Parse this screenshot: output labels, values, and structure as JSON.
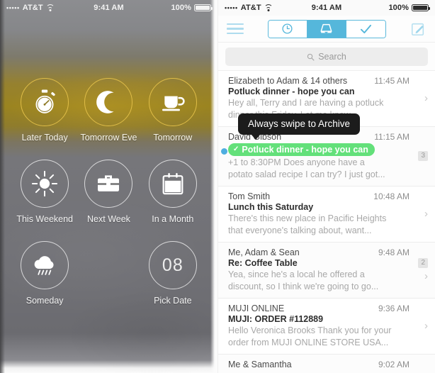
{
  "left_phone": {
    "statusbar": {
      "carrier": "AT&T",
      "signal_dots": "•••••",
      "time": "9:41 AM",
      "battery": "100%",
      "wifi_icon": "wifi-icon",
      "battery_icon": "battery-full-icon"
    },
    "snooze_options": [
      {
        "label": "Later Today",
        "icon": "stopwatch-icon",
        "accent": "gold"
      },
      {
        "label": "Tomorrow Eve",
        "icon": "moon-icon",
        "accent": "gold"
      },
      {
        "label": "Tomorrow",
        "icon": "coffee-cup-icon",
        "accent": "gold"
      },
      {
        "label": "This Weekend",
        "icon": "sun-icon",
        "accent": "white"
      },
      {
        "label": "Next Week",
        "icon": "briefcase-icon",
        "accent": "white"
      },
      {
        "label": "In a Month",
        "icon": "calendar-icon",
        "accent": "white"
      },
      {
        "label": "Someday",
        "icon": "rain-cloud-icon",
        "accent": "white"
      },
      {
        "label": "",
        "icon": "",
        "accent": "none"
      },
      {
        "label": "Pick Date",
        "icon": "date-number-icon",
        "accent": "white",
        "day_number": "08"
      }
    ]
  },
  "right_phone": {
    "statusbar": {
      "carrier": "AT&T",
      "signal_dots": "•••••",
      "time": "9:41 AM",
      "battery": "100%",
      "wifi_icon": "wifi-icon",
      "battery_icon": "battery-full-icon"
    },
    "navbar": {
      "menu_icon": "hamburger-menu-icon",
      "compose_icon": "compose-pencil-icon",
      "tabs": [
        {
          "name": "later",
          "icon": "clock-icon",
          "active": false
        },
        {
          "name": "inbox",
          "icon": "inbox-tray-icon",
          "active": true
        },
        {
          "name": "done",
          "icon": "checkmark-icon",
          "active": false
        }
      ]
    },
    "search": {
      "placeholder": "Search",
      "icon": "search-icon"
    },
    "tooltip": {
      "text": "Always swipe to Archive"
    },
    "messages": [
      {
        "from": "Elizabeth to Adam & 14 others",
        "time": "11:45 AM",
        "subject": "Potluck dinner - hope you can",
        "snippet_line1": "Hey all, Terry and I are having a potluck",
        "snippet_line2": "dinner this Friday. Let me know...",
        "chevron": true,
        "badge": "",
        "unread": false,
        "archive_pill": ""
      },
      {
        "from": "David Gibson",
        "time": "11:15 AM",
        "subject": "",
        "archive_pill": "Potluck dinner - hope you can",
        "snippet_line1": "+1 to 8:30PM Does anyone have a",
        "snippet_line2": "potato salad recipe I can try? I just got...",
        "chevron": false,
        "badge": "3",
        "unread": true
      },
      {
        "from": "Tom Smith",
        "time": "10:48 AM",
        "subject": "Lunch this Saturday",
        "snippet_line1": "There's this new place in Pacific Heights",
        "snippet_line2": "that everyone's talking about, want...",
        "chevron": true,
        "badge": "",
        "unread": false,
        "archive_pill": ""
      },
      {
        "from": "Me, Adam & Sean",
        "time": "9:48 AM",
        "subject": "Re: Coffee Table",
        "snippet_line1": "Yea, since he's a local he offered a",
        "snippet_line2": "discount, so I think we're going to go...",
        "chevron": true,
        "badge": "2",
        "unread": false,
        "archive_pill": ""
      },
      {
        "from": "MUJI ONLINE",
        "time": "9:36 AM",
        "subject": "MUJI: ORDER #112889",
        "snippet_line1": "Hello Veronica Brooks Thank you for your",
        "snippet_line2": "order from MUJI ONLINE STORE USA...",
        "chevron": true,
        "badge": "",
        "unread": false,
        "archive_pill": ""
      },
      {
        "from": "Me & Samantha",
        "time": "9:02 AM",
        "subject": "",
        "snippet_line1": "",
        "snippet_line2": "",
        "chevron": false,
        "badge": "",
        "unread": false,
        "archive_pill": ""
      }
    ]
  },
  "colors": {
    "accent_blue": "#55b7db",
    "archive_green": "#63e07a",
    "unread_dot": "#4eaee0",
    "gold_ring": "#e3c04a",
    "tooltip_bg": "#1c1c1c"
  }
}
